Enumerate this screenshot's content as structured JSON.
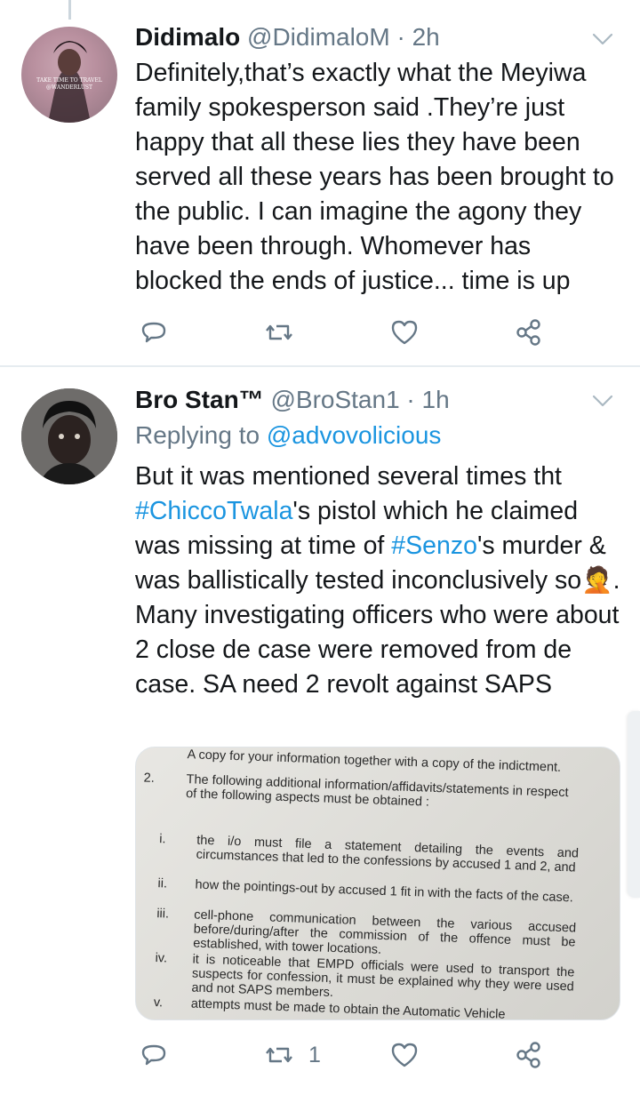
{
  "tweets": [
    {
      "display_name": "Didimalo",
      "handle": "@DidimaloM",
      "time": "2h",
      "avatar_text_1": "TAKE TIME TO TRAVEL",
      "avatar_text_2": "@WANDERLUST",
      "text": "Definitely,that’s exactly what the Meyiwa family spokesperson said .They’re just happy that all these lies they have been served all these years has been brought to the public. I can imagine the agony they have been through. Whomever has blocked the ends of justice... time is up"
    },
    {
      "display_name": "Bro Stan™",
      "handle": "@BroStan1",
      "time": "1h",
      "replying_label": "Replying to",
      "replying_to": "@advovolicious",
      "text_p1": "But it was mentioned several times tht ",
      "hashtag_1": "#ChiccoTwala",
      "text_p2": "'s pistol which he claimed was missing at time of ",
      "hashtag_2": "#Senzo",
      "text_p3": "'s murder & was ballistically tested inconclusively so",
      "emoji": "🤦",
      "text_p4": ". Many investigating officers who were about 2 close de case were removed from de case. SA need 2 revolt against SAPS",
      "retweet_count": "1",
      "document": {
        "line_top": "A copy for your information together with a copy of the indictment.",
        "item2_num": "2.",
        "item2_text": "The following additional information/affidavits/statements in respect of the following aspects must be obtained :",
        "items": [
          {
            "num": "i.",
            "text": "the i/o must file a statement detailing the events and circumstances that led to the confessions by accused 1 and 2, and"
          },
          {
            "num": "ii.",
            "text": "how the pointings-out by accused 1 fit in with the facts of the case."
          },
          {
            "num": "iii.",
            "text": "cell-phone communication between the various accused before/during/after the commission of the offence must be established, with tower locations."
          },
          {
            "num": "iv.",
            "text": "it is noticeable that EMPD officials were used to transport the suspects for confession, it must be explained why they were used and not SAPS members."
          },
          {
            "num": "v.",
            "text": "attempts must be made to obtain the Automatic Vehicle"
          }
        ]
      }
    }
  ],
  "icons": [
    "reply-icon",
    "retweet-icon",
    "like-icon",
    "share-icon",
    "chevron-down-icon"
  ],
  "colors": {
    "link": "#1b95e0",
    "muted": "#657786",
    "text": "#14171a",
    "divider": "#e6ecf0"
  }
}
